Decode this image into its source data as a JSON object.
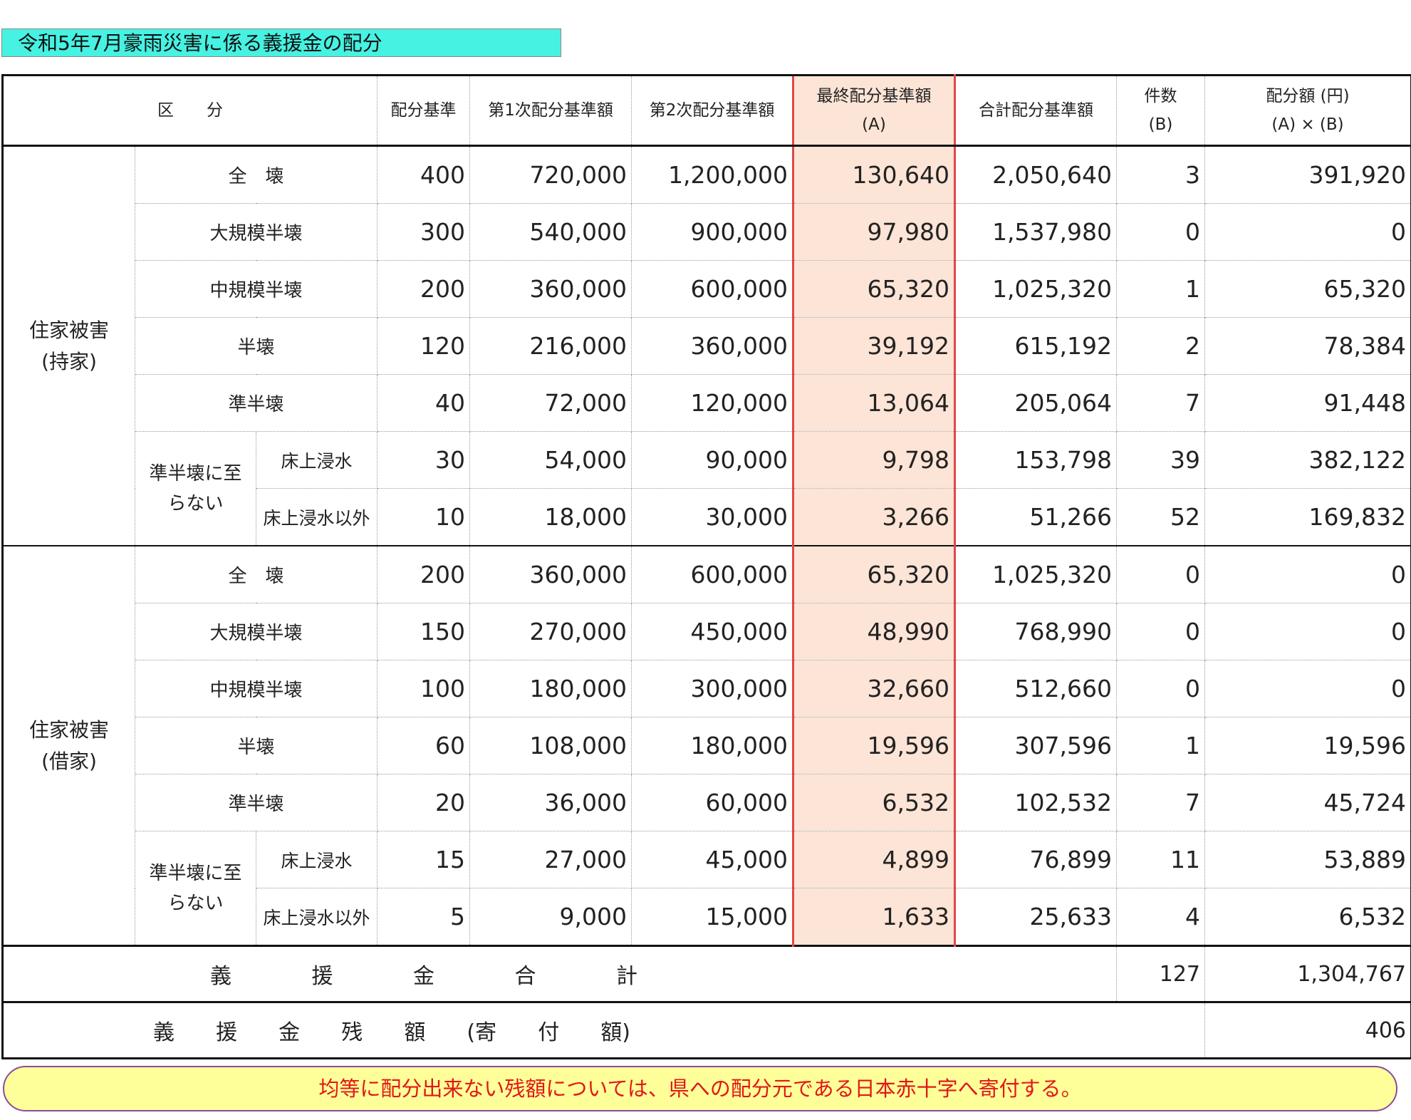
{
  "title": "令和5年7月豪雨災害に係る義援金の配分",
  "header": {
    "kubun": "区　　分",
    "kijun": "配分基準",
    "first": "第1次配分基準額",
    "second": "第2次配分基準額",
    "final_1": "最終配分基準額",
    "final_2": "(A)",
    "total": "合計配分基準額",
    "count_1": "件数",
    "count_2": "(B)",
    "amount_1": "配分額 (円)",
    "amount_2": "(A) × (B)"
  },
  "groups": [
    {
      "label_1": "住家被害",
      "label_2": "(持家)",
      "sub_label_1": "準半壊に至",
      "sub_label_2": "らない",
      "rows": [
        {
          "label": "全　壊",
          "kijun": "400",
          "first": "720,000",
          "second": "1,200,000",
          "final": "130,640",
          "total": "2,050,640",
          "count": "3",
          "amount": "391,920"
        },
        {
          "label": "大規模半壊",
          "kijun": "300",
          "first": "540,000",
          "second": "900,000",
          "final": "97,980",
          "total": "1,537,980",
          "count": "0",
          "amount": "0"
        },
        {
          "label": "中規模半壊",
          "kijun": "200",
          "first": "360,000",
          "second": "600,000",
          "final": "65,320",
          "total": "1,025,320",
          "count": "1",
          "amount": "65,320"
        },
        {
          "label": "半壊",
          "kijun": "120",
          "first": "216,000",
          "second": "360,000",
          "final": "39,192",
          "total": "615,192",
          "count": "2",
          "amount": "78,384"
        },
        {
          "label": "準半壊",
          "kijun": "40",
          "first": "72,000",
          "second": "120,000",
          "final": "13,064",
          "total": "205,064",
          "count": "7",
          "amount": "91,448"
        },
        {
          "label": "床上浸水",
          "kijun": "30",
          "first": "54,000",
          "second": "90,000",
          "final": "9,798",
          "total": "153,798",
          "count": "39",
          "amount": "382,122"
        },
        {
          "label": "床上浸水以外",
          "kijun": "10",
          "first": "18,000",
          "second": "30,000",
          "final": "3,266",
          "total": "51,266",
          "count": "52",
          "amount": "169,832"
        }
      ]
    },
    {
      "label_1": "住家被害",
      "label_2": "(借家)",
      "sub_label_1": "準半壊に至",
      "sub_label_2": "らない",
      "rows": [
        {
          "label": "全　壊",
          "kijun": "200",
          "first": "360,000",
          "second": "600,000",
          "final": "65,320",
          "total": "1,025,320",
          "count": "0",
          "amount": "0"
        },
        {
          "label": "大規模半壊",
          "kijun": "150",
          "first": "270,000",
          "second": "450,000",
          "final": "48,990",
          "total": "768,990",
          "count": "0",
          "amount": "0"
        },
        {
          "label": "中規模半壊",
          "kijun": "100",
          "first": "180,000",
          "second": "300,000",
          "final": "32,660",
          "total": "512,660",
          "count": "0",
          "amount": "0"
        },
        {
          "label": "半壊",
          "kijun": "60",
          "first": "108,000",
          "second": "180,000",
          "final": "19,596",
          "total": "307,596",
          "count": "1",
          "amount": "19,596"
        },
        {
          "label": "準半壊",
          "kijun": "20",
          "first": "36,000",
          "second": "60,000",
          "final": "6,532",
          "total": "102,532",
          "count": "7",
          "amount": "45,724"
        },
        {
          "label": "床上浸水",
          "kijun": "15",
          "first": "27,000",
          "second": "45,000",
          "final": "4,899",
          "total": "76,899",
          "count": "11",
          "amount": "53,889"
        },
        {
          "label": "床上浸水以外",
          "kijun": "5",
          "first": "9,000",
          "second": "15,000",
          "final": "1,633",
          "total": "25,633",
          "count": "4",
          "amount": "6,532"
        }
      ]
    }
  ],
  "total_row": {
    "label_chars": [
      "義",
      "援",
      "金",
      "合",
      "計"
    ],
    "count": "127",
    "amount": "1,304,767"
  },
  "remainder_row": {
    "label_chars": [
      "義",
      "援",
      "金",
      "残",
      "額",
      "(寄",
      "付",
      "額)"
    ],
    "amount": "406"
  },
  "note": "均等に配分出来ない残額については、県への配分元である日本赤十字へ寄付する。",
  "colors": {
    "title_bg": "#46f2e2",
    "highlight_bg": "#fce4d6",
    "highlight_border": "#e04848",
    "note_bg": "#ffff99",
    "note_text": "#e01818"
  }
}
